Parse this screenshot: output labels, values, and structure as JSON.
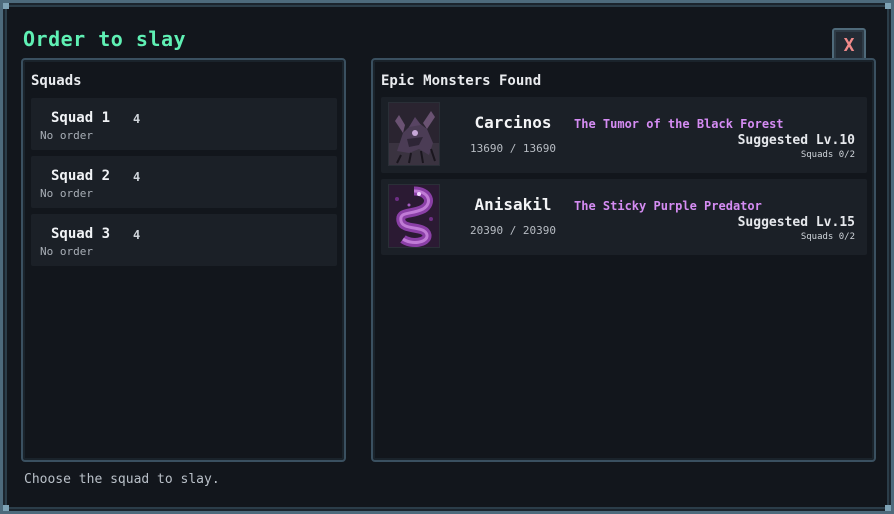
{
  "window": {
    "title": "Order to slay",
    "close_label": "X"
  },
  "squads_panel": {
    "title": "Squads",
    "squads": [
      {
        "name": "Squad 1",
        "count": "4",
        "order": "No order"
      },
      {
        "name": "Squad 2",
        "count": "4",
        "order": "No order"
      },
      {
        "name": "Squad 3",
        "count": "4",
        "order": "No order"
      }
    ]
  },
  "monsters_panel": {
    "title": "Epic Monsters Found",
    "monsters": [
      {
        "name": "Carcinos",
        "hp": "13690 / 13690",
        "epithet": "The Tumor of the Black Forest",
        "suggested": "Suggested Lv.10",
        "squads": "Squads 0/2"
      },
      {
        "name": "Anisakil",
        "hp": "20390 / 20390",
        "epithet": "The Sticky Purple Predator",
        "suggested": "Suggested Lv.15",
        "squads": "Squads 0/2"
      }
    ]
  },
  "footer": {
    "hint": "Choose the squad to slay."
  },
  "colors": {
    "title": "#5ff0b4",
    "epithet": "#d58cf3",
    "close": "#f08a8a",
    "frame": "#4d6a7c"
  }
}
